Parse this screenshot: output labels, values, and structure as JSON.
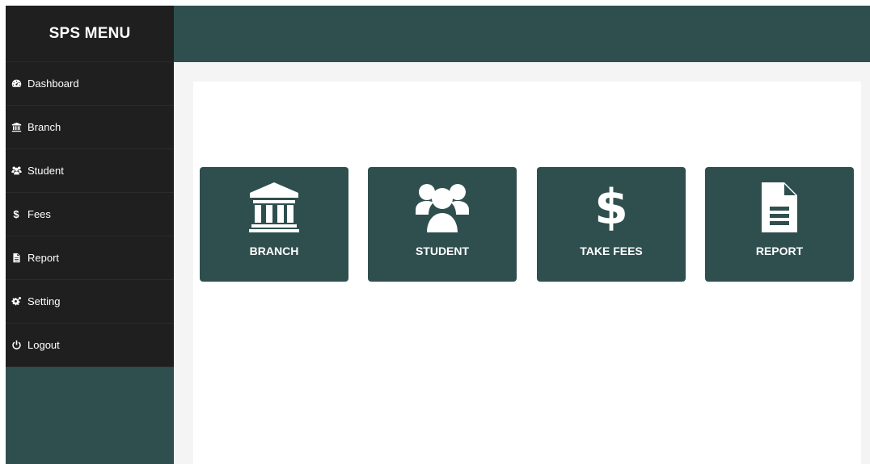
{
  "sidebar": {
    "title": "SPS MENU",
    "items": [
      {
        "label": "Dashboard",
        "icon": "dashboard-icon"
      },
      {
        "label": "Branch",
        "icon": "bank-icon"
      },
      {
        "label": "Student",
        "icon": "users-icon"
      },
      {
        "label": "Fees",
        "icon": "dollar-icon",
        "glyph": "$"
      },
      {
        "label": "Report",
        "icon": "file-icon"
      },
      {
        "label": "Setting",
        "icon": "cogs-icon"
      },
      {
        "label": "Logout",
        "icon": "power-icon"
      }
    ]
  },
  "tiles": [
    {
      "label": "BRANCH",
      "icon": "bank-icon"
    },
    {
      "label": "STUDENT",
      "icon": "users-icon"
    },
    {
      "label": "TAKE FEES",
      "icon": "dollar-icon",
      "glyph": "$"
    },
    {
      "label": "REPORT",
      "icon": "file-text-icon"
    }
  ],
  "colors": {
    "primary": "#2f4f4f",
    "sidebar_dark": "#1f1f1f",
    "content_bg": "#f4f4f4",
    "text": "#ffffff"
  }
}
